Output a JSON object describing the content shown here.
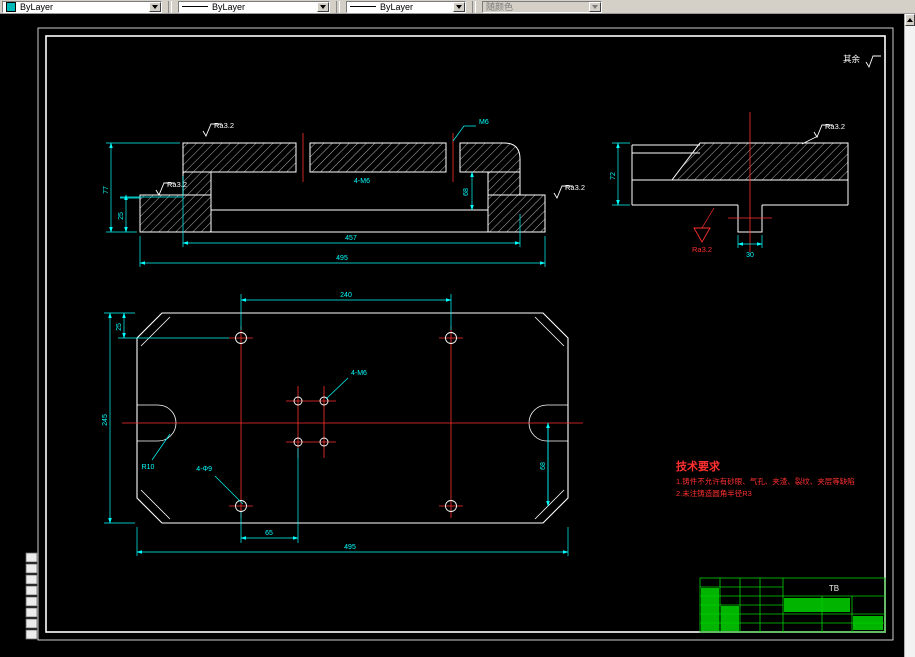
{
  "toolbar": {
    "color": {
      "label": "ByLayer"
    },
    "linetype": {
      "label": "ByLayer"
    },
    "lineweight": {
      "label": "ByLayer"
    },
    "plot_style": {
      "label": "随颜色"
    }
  },
  "palette": {
    "outline": "#ffffff",
    "dimension": "#00ffff",
    "centerline": "#ff3030",
    "tech_text": "#ff3030",
    "title_block": "#00c000",
    "toolbar_bg": "#d4d0c8"
  },
  "sheet": {
    "general_roughness_prefix": "其余",
    "roughness_value": "Ra3.2",
    "tech_requirements": {
      "title": "技术要求",
      "notes": [
        "1.铸件不允许有砂眼、气孔、夹渣、裂纹、夹层等缺陷",
        "2.未注铸造圆角半径R3"
      ]
    },
    "title_block": {
      "code": "TB"
    },
    "dims": {
      "front": {
        "inner_width": "457",
        "overall_width": "495",
        "height": "77",
        "foot_height": "25",
        "cavity_height": "68",
        "thread_callout": "M6",
        "thread_group": "4-M6"
      },
      "plan": {
        "hole_span": "240",
        "overall_height": "245",
        "edge_offset": "25",
        "right_offset": "68",
        "center_offset": "65",
        "overall_width": "495",
        "corner_holes": "4-Φ9",
        "center_holes": "4-M6",
        "slot_radius": "R10"
      },
      "side": {
        "height": "72",
        "boss_width": "30"
      }
    }
  }
}
